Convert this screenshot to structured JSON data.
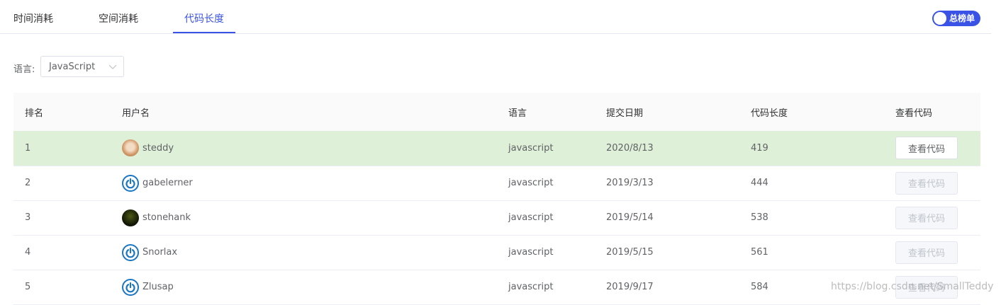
{
  "tabs": [
    {
      "label": "时间消耗",
      "active": false
    },
    {
      "label": "空间消耗",
      "active": false
    },
    {
      "label": "代码长度",
      "active": true
    }
  ],
  "toggle": {
    "label": "总榜单",
    "on": true
  },
  "filter": {
    "label": "语言:",
    "selected": "JavaScript"
  },
  "table": {
    "headers": [
      "排名",
      "用户名",
      "语言",
      "提交日期",
      "代码长度",
      "查看代码"
    ],
    "rows": [
      {
        "rank": "1",
        "user": "steddy",
        "avatar": "dog-avatar",
        "lang": "javascript",
        "date": "2020/8/13",
        "length": "419",
        "button": "查看代码",
        "enabled": true,
        "highlight": true
      },
      {
        "rank": "2",
        "user": "gabelerner",
        "avatar": "power-avatar",
        "lang": "javascript",
        "date": "2019/3/13",
        "length": "444",
        "button": "查看代码",
        "enabled": false,
        "highlight": false
      },
      {
        "rank": "3",
        "user": "stonehank",
        "avatar": "dark-avatar",
        "lang": "javascript",
        "date": "2019/5/14",
        "length": "538",
        "button": "查看代码",
        "enabled": false,
        "highlight": false
      },
      {
        "rank": "4",
        "user": "Snorlax",
        "avatar": "power-avatar",
        "lang": "javascript",
        "date": "2019/5/15",
        "length": "561",
        "button": "查看代码",
        "enabled": false,
        "highlight": false
      },
      {
        "rank": "5",
        "user": "Zlusap",
        "avatar": "power-avatar",
        "lang": "javascript",
        "date": "2019/9/17",
        "length": "584",
        "button": "查看代码",
        "enabled": false,
        "highlight": false
      }
    ]
  },
  "watermark": "https://blog.csdn.net/SmallTeddy",
  "colors": {
    "accent": "#3a53e6",
    "highlight_row": "#dff0d8"
  }
}
